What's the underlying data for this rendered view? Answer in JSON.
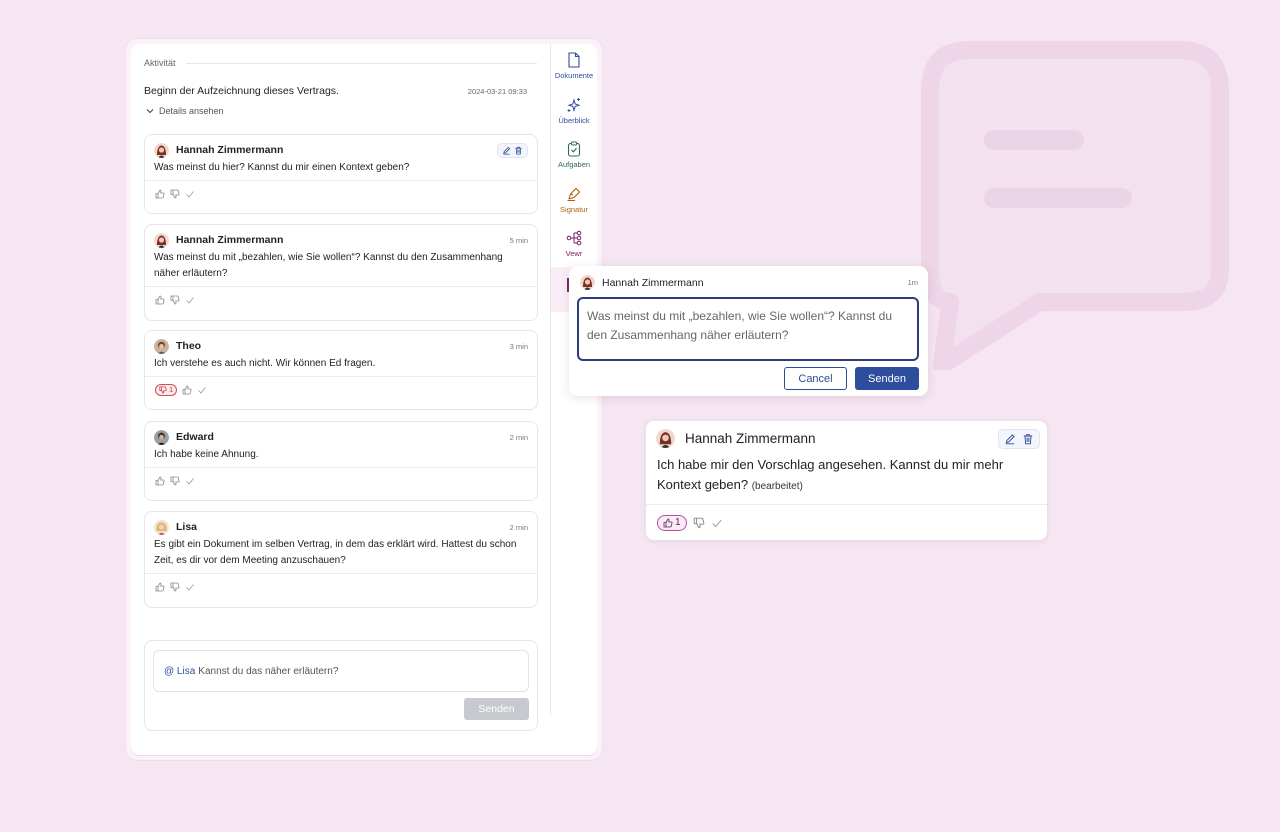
{
  "activity": {
    "header": "Aktivität",
    "record_text": "Beginn der Aufzeichnung dieses Vertrags.",
    "record_time": "2024-03-21 09:33",
    "details_label": "Details ansehen"
  },
  "comments": [
    {
      "author": "Hannah Zimmermann",
      "time": "",
      "text": "Was meinst du hier? Kannst du mir einen Kontext geben?"
    },
    {
      "author": "Hannah Zimmermann",
      "time": "5 min",
      "text": "Was meinst du mit „bezahlen, wie Sie wollen“? Kannst du den Zusammenhang näher erläutern?"
    },
    {
      "author": "Theo",
      "time": "3 min",
      "text": "Ich verstehe es auch nicht. Wir können Ed fragen.",
      "dislikes": "1"
    },
    {
      "author": "Edward",
      "time": "2 min",
      "text": "Ich habe keine Ahnung."
    },
    {
      "author": "Lisa",
      "time": "2 min",
      "text": "Es gibt ein Dokument im selben Vertrag, in dem das erklärt wird. Hattest du schon Zeit, es dir vor dem Meeting anzuschauen?"
    }
  ],
  "composer": {
    "mention": "@ Lisa",
    "text": "Kannst du das näher erläutern?",
    "send_label": "Senden"
  },
  "sidebar": {
    "items": [
      {
        "label": "Dokumente",
        "icon": "document-icon",
        "color": "#2e4e9d"
      },
      {
        "label": "Überblick",
        "icon": "sparkle-icon",
        "color": "#2e4e9d"
      },
      {
        "label": "Aufgaben",
        "icon": "clipboard-check-icon",
        "color": "#2f6b52"
      },
      {
        "label": "Signatur",
        "icon": "pen-icon",
        "color": "#b0600a"
      },
      {
        "label": "Vewr",
        "icon": "hierarchy-icon",
        "color": "#7a1f5e"
      }
    ]
  },
  "edit_popup": {
    "author": "Hannah Zimmermann",
    "time": "1m",
    "text": "Was meinst du mit „bezahlen, wie Sie wollen“? Kannst du den Zusammenhang näher erläutern?",
    "cancel_label": "Cancel",
    "send_label": "Senden"
  },
  "featured_comment": {
    "author": "Hannah Zimmermann",
    "text": "Ich habe mir den Vorschlag angesehen. Kannst du mir mehr Kontext geben?",
    "edited_label": "(bearbeitet)",
    "likes": "1"
  },
  "colors": {
    "background": "#f5e6f1",
    "primary": "#2e4e9d",
    "dislike_red": "#d24d57",
    "like_purple": "#b44fa6"
  }
}
